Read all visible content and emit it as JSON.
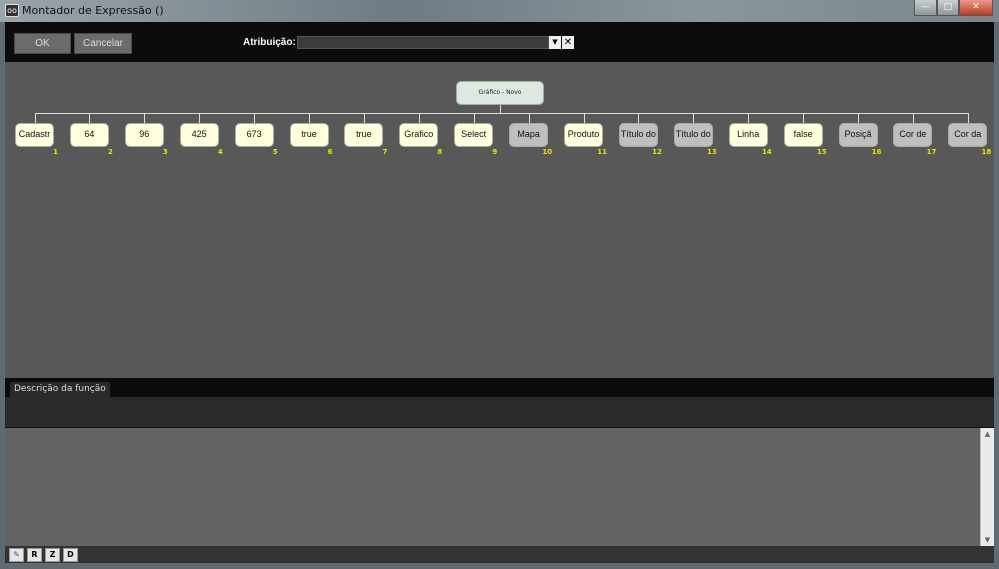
{
  "window": {
    "title": "Montador de Expressão ()",
    "minimize": "—",
    "maximize": "□",
    "close": "✕"
  },
  "toolbar": {
    "ok_label": "OK",
    "cancel_label": "Cancelar",
    "attribution_label": "Atribuição:",
    "attribution_value": "",
    "dropdown_icon": "▼",
    "clear_icon": "✕"
  },
  "tree": {
    "root": "Gráfico - Novo",
    "nodes": [
      {
        "label": "Cadastr",
        "num": "1",
        "color": "y"
      },
      {
        "label": "64",
        "num": "2",
        "color": "y"
      },
      {
        "label": "96",
        "num": "3",
        "color": "y"
      },
      {
        "label": "425",
        "num": "4",
        "color": "y"
      },
      {
        "label": "673",
        "num": "5",
        "color": "y"
      },
      {
        "label": "true",
        "num": "6",
        "color": "y"
      },
      {
        "label": "true",
        "num": "7",
        "color": "y"
      },
      {
        "label": "Grafico",
        "num": "8",
        "color": "y"
      },
      {
        "label": "Select",
        "num": "9",
        "color": "y"
      },
      {
        "label": "Mapa",
        "num": "10",
        "color": "g"
      },
      {
        "label": "Produto",
        "num": "11",
        "color": "y"
      },
      {
        "label": "Título do",
        "num": "12",
        "color": "g"
      },
      {
        "label": "Título do",
        "num": "13",
        "color": "g"
      },
      {
        "label": "Linha",
        "num": "14",
        "color": "y"
      },
      {
        "label": "false",
        "num": "15",
        "color": "y"
      },
      {
        "label": "Posiçã",
        "num": "16",
        "color": "g"
      },
      {
        "label": "Cor de",
        "num": "17",
        "color": "g"
      },
      {
        "label": "Cor da",
        "num": "18",
        "color": "g"
      }
    ]
  },
  "panel": {
    "tab_label": "Descrição da função",
    "description": "",
    "scroll_up": "▲",
    "scroll_down": "▼"
  },
  "bottom": {
    "buttons": [
      {
        "label": "✎",
        "name": "edit"
      },
      {
        "label": "R",
        "name": "r"
      },
      {
        "label": "Z",
        "name": "z"
      },
      {
        "label": "D",
        "name": "d"
      }
    ]
  },
  "colors": {
    "node_value": "#ffffdd",
    "node_function": "#bfbfbf",
    "root": "#dbe9e1",
    "index": "#e8e800"
  }
}
